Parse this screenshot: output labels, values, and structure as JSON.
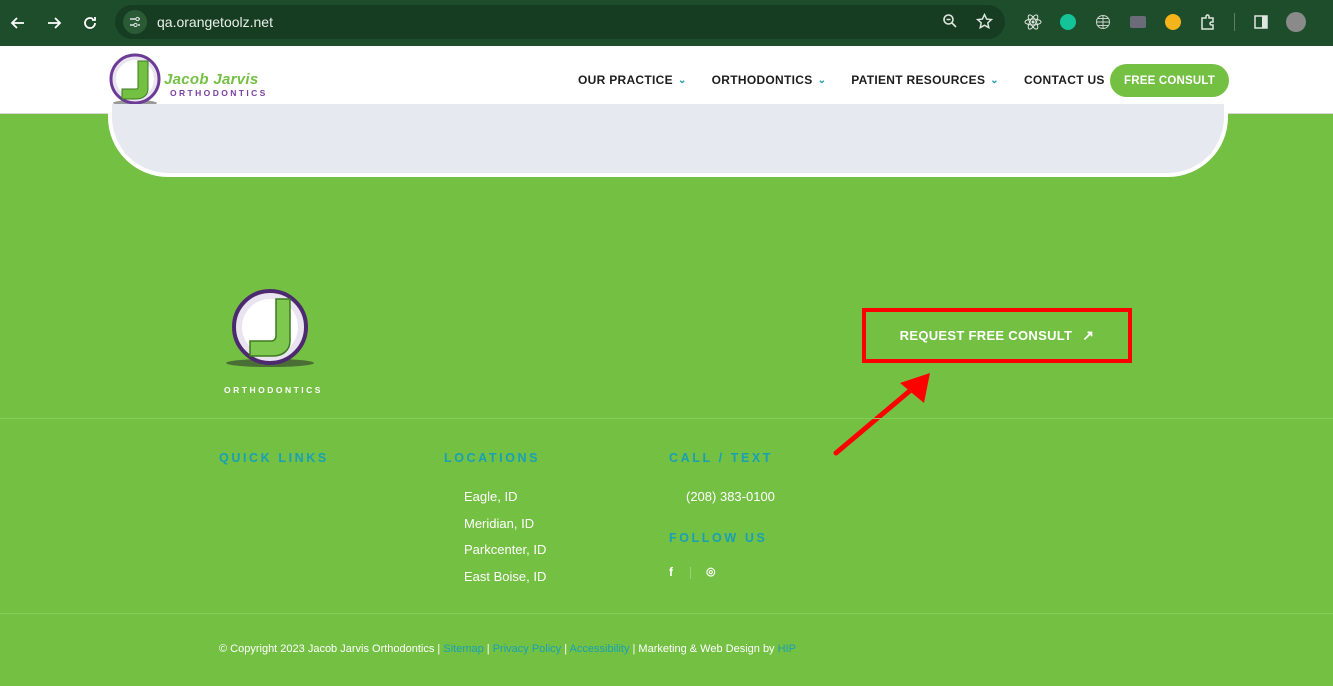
{
  "browser": {
    "url": "qa.orangetoolz.net"
  },
  "header": {
    "logo_name": "Jacob Jarvis",
    "logo_sub": "ORTHODONTICS",
    "menu": [
      {
        "label": "OUR PRACTICE"
      },
      {
        "label": "ORTHODONTICS"
      },
      {
        "label": "PATIENT RESOURCES"
      },
      {
        "label": "CONTACT US"
      }
    ],
    "cta_label": "FREE CONSULT"
  },
  "footer": {
    "logo_sub": "ORTHODONTICS",
    "request_label": "REQUEST FREE CONSULT",
    "request_arrow": "↗",
    "quick_links_heading": "QUICK LINKS",
    "locations_heading": "LOCATIONS",
    "locations": [
      "Eagle, ID",
      "Meridian, ID",
      "Parkcenter, ID",
      "East Boise, ID"
    ],
    "call_heading": "CALL / TEXT",
    "phone": "(208) 383-0100",
    "follow_heading": "FOLLOW US",
    "social": [
      "f",
      "◎"
    ],
    "copyright": {
      "text": "© Copyright 2023 Jacob Jarvis Orthodontics | ",
      "sitemap": "Sitemap",
      "sep1": " | ",
      "privacy": "Privacy Policy",
      "sep2": " | ",
      "accessibility": "Accessibility",
      "marketing": " | Marketing & Web Design by ",
      "hip": "HIP"
    }
  },
  "colors": {
    "brand_green": "#74c043",
    "accent_teal": "#19a0b4",
    "highlight_red": "#ff0000"
  }
}
